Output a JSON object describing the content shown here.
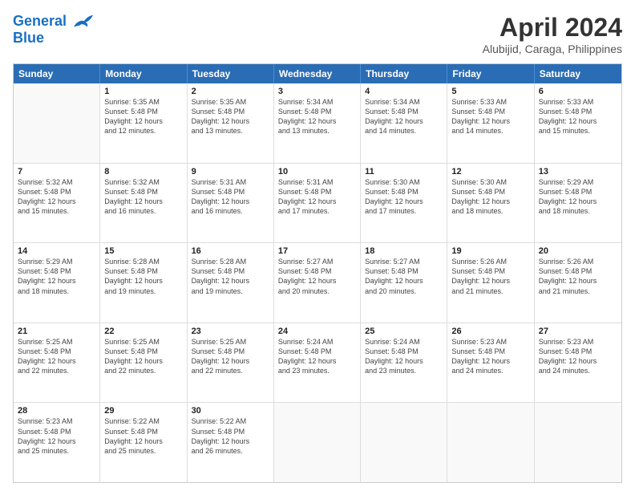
{
  "header": {
    "logo_text1": "General",
    "logo_text2": "Blue",
    "title": "April 2024",
    "subtitle": "Alubijid, Caraga, Philippines"
  },
  "weekdays": [
    "Sunday",
    "Monday",
    "Tuesday",
    "Wednesday",
    "Thursday",
    "Friday",
    "Saturday"
  ],
  "weeks": [
    [
      {
        "day": "",
        "info": ""
      },
      {
        "day": "1",
        "info": "Sunrise: 5:35 AM\nSunset: 5:48 PM\nDaylight: 12 hours\nand 12 minutes."
      },
      {
        "day": "2",
        "info": "Sunrise: 5:35 AM\nSunset: 5:48 PM\nDaylight: 12 hours\nand 13 minutes."
      },
      {
        "day": "3",
        "info": "Sunrise: 5:34 AM\nSunset: 5:48 PM\nDaylight: 12 hours\nand 13 minutes."
      },
      {
        "day": "4",
        "info": "Sunrise: 5:34 AM\nSunset: 5:48 PM\nDaylight: 12 hours\nand 14 minutes."
      },
      {
        "day": "5",
        "info": "Sunrise: 5:33 AM\nSunset: 5:48 PM\nDaylight: 12 hours\nand 14 minutes."
      },
      {
        "day": "6",
        "info": "Sunrise: 5:33 AM\nSunset: 5:48 PM\nDaylight: 12 hours\nand 15 minutes."
      }
    ],
    [
      {
        "day": "7",
        "info": "Sunrise: 5:32 AM\nSunset: 5:48 PM\nDaylight: 12 hours\nand 15 minutes."
      },
      {
        "day": "8",
        "info": "Sunrise: 5:32 AM\nSunset: 5:48 PM\nDaylight: 12 hours\nand 16 minutes."
      },
      {
        "day": "9",
        "info": "Sunrise: 5:31 AM\nSunset: 5:48 PM\nDaylight: 12 hours\nand 16 minutes."
      },
      {
        "day": "10",
        "info": "Sunrise: 5:31 AM\nSunset: 5:48 PM\nDaylight: 12 hours\nand 17 minutes."
      },
      {
        "day": "11",
        "info": "Sunrise: 5:30 AM\nSunset: 5:48 PM\nDaylight: 12 hours\nand 17 minutes."
      },
      {
        "day": "12",
        "info": "Sunrise: 5:30 AM\nSunset: 5:48 PM\nDaylight: 12 hours\nand 18 minutes."
      },
      {
        "day": "13",
        "info": "Sunrise: 5:29 AM\nSunset: 5:48 PM\nDaylight: 12 hours\nand 18 minutes."
      }
    ],
    [
      {
        "day": "14",
        "info": "Sunrise: 5:29 AM\nSunset: 5:48 PM\nDaylight: 12 hours\nand 18 minutes."
      },
      {
        "day": "15",
        "info": "Sunrise: 5:28 AM\nSunset: 5:48 PM\nDaylight: 12 hours\nand 19 minutes."
      },
      {
        "day": "16",
        "info": "Sunrise: 5:28 AM\nSunset: 5:48 PM\nDaylight: 12 hours\nand 19 minutes."
      },
      {
        "day": "17",
        "info": "Sunrise: 5:27 AM\nSunset: 5:48 PM\nDaylight: 12 hours\nand 20 minutes."
      },
      {
        "day": "18",
        "info": "Sunrise: 5:27 AM\nSunset: 5:48 PM\nDaylight: 12 hours\nand 20 minutes."
      },
      {
        "day": "19",
        "info": "Sunrise: 5:26 AM\nSunset: 5:48 PM\nDaylight: 12 hours\nand 21 minutes."
      },
      {
        "day": "20",
        "info": "Sunrise: 5:26 AM\nSunset: 5:48 PM\nDaylight: 12 hours\nand 21 minutes."
      }
    ],
    [
      {
        "day": "21",
        "info": "Sunrise: 5:25 AM\nSunset: 5:48 PM\nDaylight: 12 hours\nand 22 minutes."
      },
      {
        "day": "22",
        "info": "Sunrise: 5:25 AM\nSunset: 5:48 PM\nDaylight: 12 hours\nand 22 minutes."
      },
      {
        "day": "23",
        "info": "Sunrise: 5:25 AM\nSunset: 5:48 PM\nDaylight: 12 hours\nand 22 minutes."
      },
      {
        "day": "24",
        "info": "Sunrise: 5:24 AM\nSunset: 5:48 PM\nDaylight: 12 hours\nand 23 minutes."
      },
      {
        "day": "25",
        "info": "Sunrise: 5:24 AM\nSunset: 5:48 PM\nDaylight: 12 hours\nand 23 minutes."
      },
      {
        "day": "26",
        "info": "Sunrise: 5:23 AM\nSunset: 5:48 PM\nDaylight: 12 hours\nand 24 minutes."
      },
      {
        "day": "27",
        "info": "Sunrise: 5:23 AM\nSunset: 5:48 PM\nDaylight: 12 hours\nand 24 minutes."
      }
    ],
    [
      {
        "day": "28",
        "info": "Sunrise: 5:23 AM\nSunset: 5:48 PM\nDaylight: 12 hours\nand 25 minutes."
      },
      {
        "day": "29",
        "info": "Sunrise: 5:22 AM\nSunset: 5:48 PM\nDaylight: 12 hours\nand 25 minutes."
      },
      {
        "day": "30",
        "info": "Sunrise: 5:22 AM\nSunset: 5:48 PM\nDaylight: 12 hours\nand 26 minutes."
      },
      {
        "day": "",
        "info": ""
      },
      {
        "day": "",
        "info": ""
      },
      {
        "day": "",
        "info": ""
      },
      {
        "day": "",
        "info": ""
      }
    ]
  ]
}
